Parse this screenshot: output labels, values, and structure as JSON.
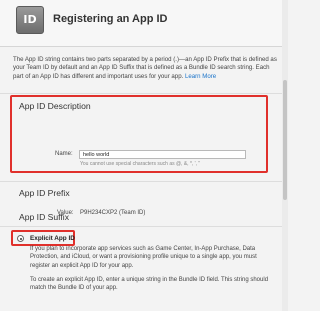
{
  "header": {
    "icon_text": "ID",
    "title": "Registering an App ID"
  },
  "intro": {
    "text": "The App ID string contains two parts separated by a period (.)—an App ID Prefix that is defined as your Team ID by default and an App ID Suffix that is defined as a Bundle ID search string. Each part of an App ID has different and important uses for your app. ",
    "link": "Learn More"
  },
  "description": {
    "heading": "App ID Description",
    "name_label": "Name:",
    "name_value": "hello world",
    "hint": "You cannot use special characters such as @, &, *, ', \""
  },
  "prefix": {
    "heading": "App ID Prefix",
    "value_label": "Value:",
    "value": "P9H234CXP2 (Team ID)"
  },
  "suffix": {
    "heading": "App ID Suffix",
    "option_title": "Explicit App ID",
    "option_text_1": "If you plan to incorporate app services such as Game Center, In-App Purchase, Data Protection, and iCloud, or want a provisioning profile unique to a single app, you must register an explicit App ID for your app.",
    "option_text_2": "To create an explicit App ID, enter a unique string in the Bundle ID field. This string should match the Bundle ID of your app."
  },
  "colors": {
    "highlight": "#e0302b",
    "link": "#1a73c9"
  }
}
